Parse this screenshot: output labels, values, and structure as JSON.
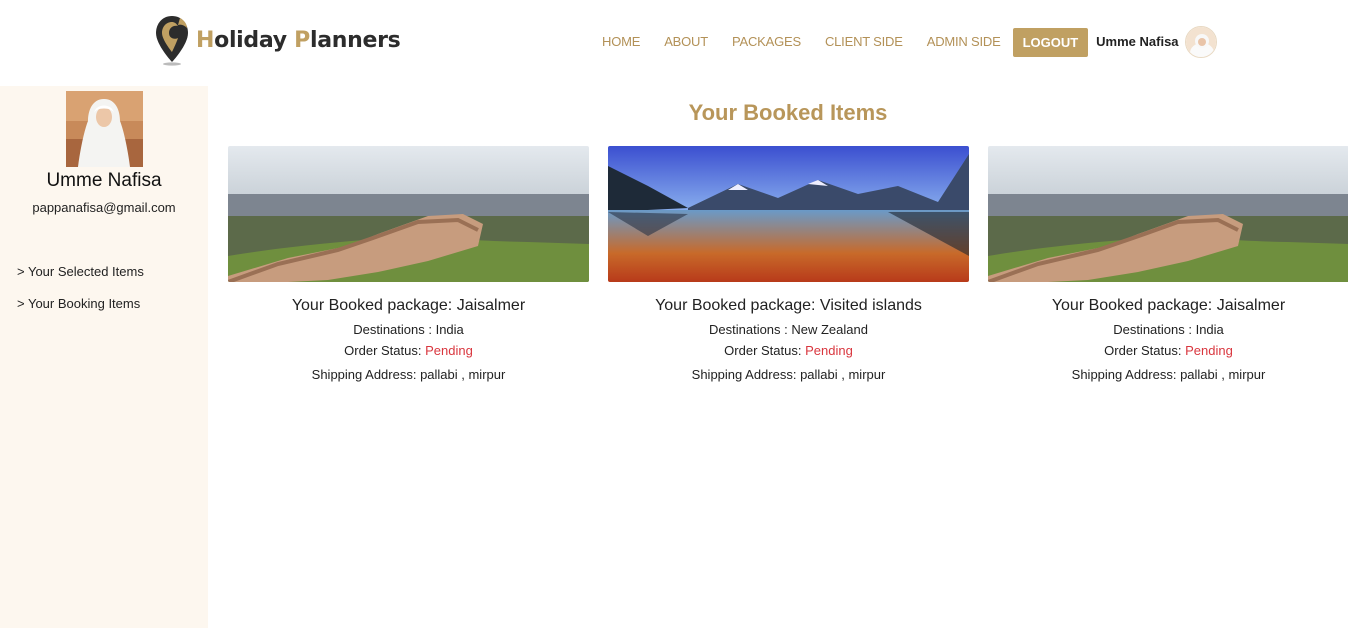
{
  "brand": {
    "name_part1": "H",
    "name_part2": "oliday ",
    "name_part3": "P",
    "name_part4": "lanners"
  },
  "nav": {
    "items": [
      "HOME",
      "ABOUT",
      "PACKAGES",
      "CLIENT SIDE",
      "ADMIN SIDE"
    ],
    "logout_label": "LOGOUT",
    "user_name": "Umme Nafisa"
  },
  "sidebar": {
    "name": "Umme Nafisa",
    "email": "pappanafisa@gmail.com",
    "items": [
      "> Your Selected Items",
      "> Your Booking Items"
    ]
  },
  "main": {
    "title": "Your Booked Items",
    "cards": [
      {
        "title": "Your Booked package: Jaisalmer",
        "dest_label": "Destinations : ",
        "dest": "India",
        "status_label": "Order Status: ",
        "status": "Pending",
        "ship_label": "Shipping Address: ",
        "ship": "pallabi , mirpur"
      },
      {
        "title": "Your Booked package: Visited islands",
        "dest_label": "Destinations : ",
        "dest": "New Zealand",
        "status_label": "Order Status: ",
        "status": "Pending",
        "ship_label": "Shipping Address: ",
        "ship": "pallabi , mirpur"
      },
      {
        "title": "Your Booked package: Jaisalmer",
        "dest_label": "Destinations : ",
        "dest": "India",
        "status_label": "Order Status: ",
        "status": "Pending",
        "ship_label": "Shipping Address: ",
        "ship": "pallabi , mirpur"
      }
    ]
  },
  "colors": {
    "accent": "#c0a062",
    "title": "#b8965a",
    "pending": "#d9363e",
    "sidebar_bg": "#fdf7ef"
  }
}
